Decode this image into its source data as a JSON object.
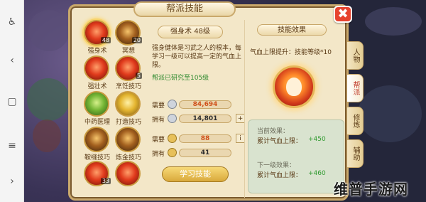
{
  "window": {
    "title": "帮派技能",
    "close_label": "✖"
  },
  "skills": [
    {
      "name": "强身术",
      "level": "48",
      "variant": "red",
      "selected": true
    },
    {
      "name": "冥想",
      "level": "20",
      "variant": "dark",
      "selected": false
    },
    {
      "name": "强壮术",
      "level": "",
      "variant": "red",
      "selected": false
    },
    {
      "name": "烹饪技巧",
      "level": "5",
      "variant": "red",
      "selected": false
    },
    {
      "name": "中药医理",
      "level": "",
      "variant": "green",
      "selected": false
    },
    {
      "name": "打造技巧",
      "level": "",
      "variant": "gold",
      "selected": false
    },
    {
      "name": "鞍缝技巧",
      "level": "",
      "variant": "dark",
      "selected": false
    },
    {
      "name": "炼金技巧",
      "level": "",
      "variant": "dark",
      "selected": false
    },
    {
      "name": "",
      "level": "33",
      "variant": "red",
      "selected": false
    },
    {
      "name": "",
      "level": "",
      "variant": "red",
      "selected": false
    }
  ],
  "detail": {
    "skill_title": "强身术 48级",
    "description": "强身健体是习武之人的根本，每学习一级可以提高一定的气血上限。",
    "requirement": "帮派已研究至105级",
    "rows": [
      {
        "label": "需要",
        "value": "84,694",
        "color": "#d0521c",
        "coin": "silver",
        "plus": false
      },
      {
        "label": "拥有",
        "value": "14,801",
        "color": "#2e2e2e",
        "coin": "silver",
        "plus": true
      },
      {
        "label": "需要",
        "value": "88",
        "color": "#d0521c",
        "coin": "gold",
        "plus": false,
        "info": "i"
      },
      {
        "label": "拥有",
        "value": "41",
        "color": "#2e2e2e",
        "coin": "gold",
        "plus": false
      }
    ],
    "learn_button": "学习技能"
  },
  "effect": {
    "title": "技能效果",
    "line": "气血上限提升：技能等级*10",
    "current_header": "当前效果：",
    "current_label": "累计气血上限：",
    "current_value": "+450",
    "next_header": "下一级效果：",
    "next_label": "累计气血上限：",
    "next_value": "+460"
  },
  "side_tabs": [
    {
      "label": "人物",
      "active": false
    },
    {
      "label": "帮派",
      "active": true
    },
    {
      "label": "修炼",
      "active": false
    },
    {
      "label": "辅助",
      "active": false
    }
  ],
  "watermark": "维普手游网",
  "colors": {
    "accent": "#c9a86b",
    "panel": "#f3e7c8",
    "close": "#e7432f",
    "green": "#2f9a2f"
  }
}
